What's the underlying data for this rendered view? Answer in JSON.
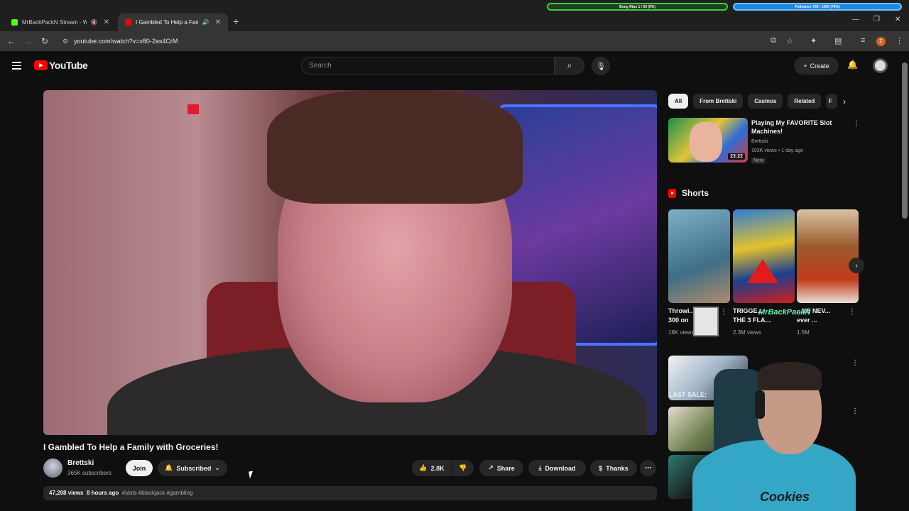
{
  "browser": {
    "tabs": [
      {
        "title": "MrBackPackN Stream - Watch",
        "favicon_color": "#53fc18",
        "active": false
      },
      {
        "title": "I Gambled To Help a Family",
        "favicon_color": "#ff0000",
        "active": true
      }
    ],
    "url": "youtube.com/watch?v=v80-2as4CrM",
    "overlay_bars": [
      {
        "label": "Bong Rips 1 / 30 (5%)",
        "color": "#2f7d2f"
      },
      {
        "label": "Followers 785 / 1000 (79%)",
        "color": "#1e88e5"
      }
    ],
    "profile_letter": "Z"
  },
  "youtube": {
    "logo_text": "YouTube",
    "search_placeholder": "Search",
    "create_label": "Create"
  },
  "video": {
    "title": "I Gambled To Help a Family with Groceries!",
    "channel": "Brettski",
    "subscribers": "365K subscribers",
    "join_label": "Join",
    "subscribed_label": "Subscribed",
    "likes": "2.8K",
    "share_label": "Share",
    "download_label": "Download",
    "thanks_label": "Thanks",
    "views": "47,208 views",
    "age": "8 hours ago",
    "hashtags": "#slots #blackjack #gambling"
  },
  "sidebar": {
    "chips": [
      "All",
      "From Brettski",
      "Casinos",
      "Related",
      "F"
    ],
    "recommendation": {
      "title": "Playing My FAVORITE Slot Machines!",
      "channel": "Brettski",
      "meta": "103K views • 1 day ago",
      "badge": "New",
      "duration": "23:22"
    },
    "shorts_heading": "Shorts",
    "shorts": [
      {
        "title": "Throwi... 300 on",
        "views": "18K views"
      },
      {
        "title": "TRIGGE... THE 3 FLA...",
        "views": "2.3M views"
      },
      {
        "title": "...YS NEV... ever ...",
        "views": "1.5M"
      }
    ],
    "last_sale": "LAST SALE:"
  },
  "stream_overlay": {
    "name": "MrBackPackN",
    "brand": "Cookies"
  }
}
